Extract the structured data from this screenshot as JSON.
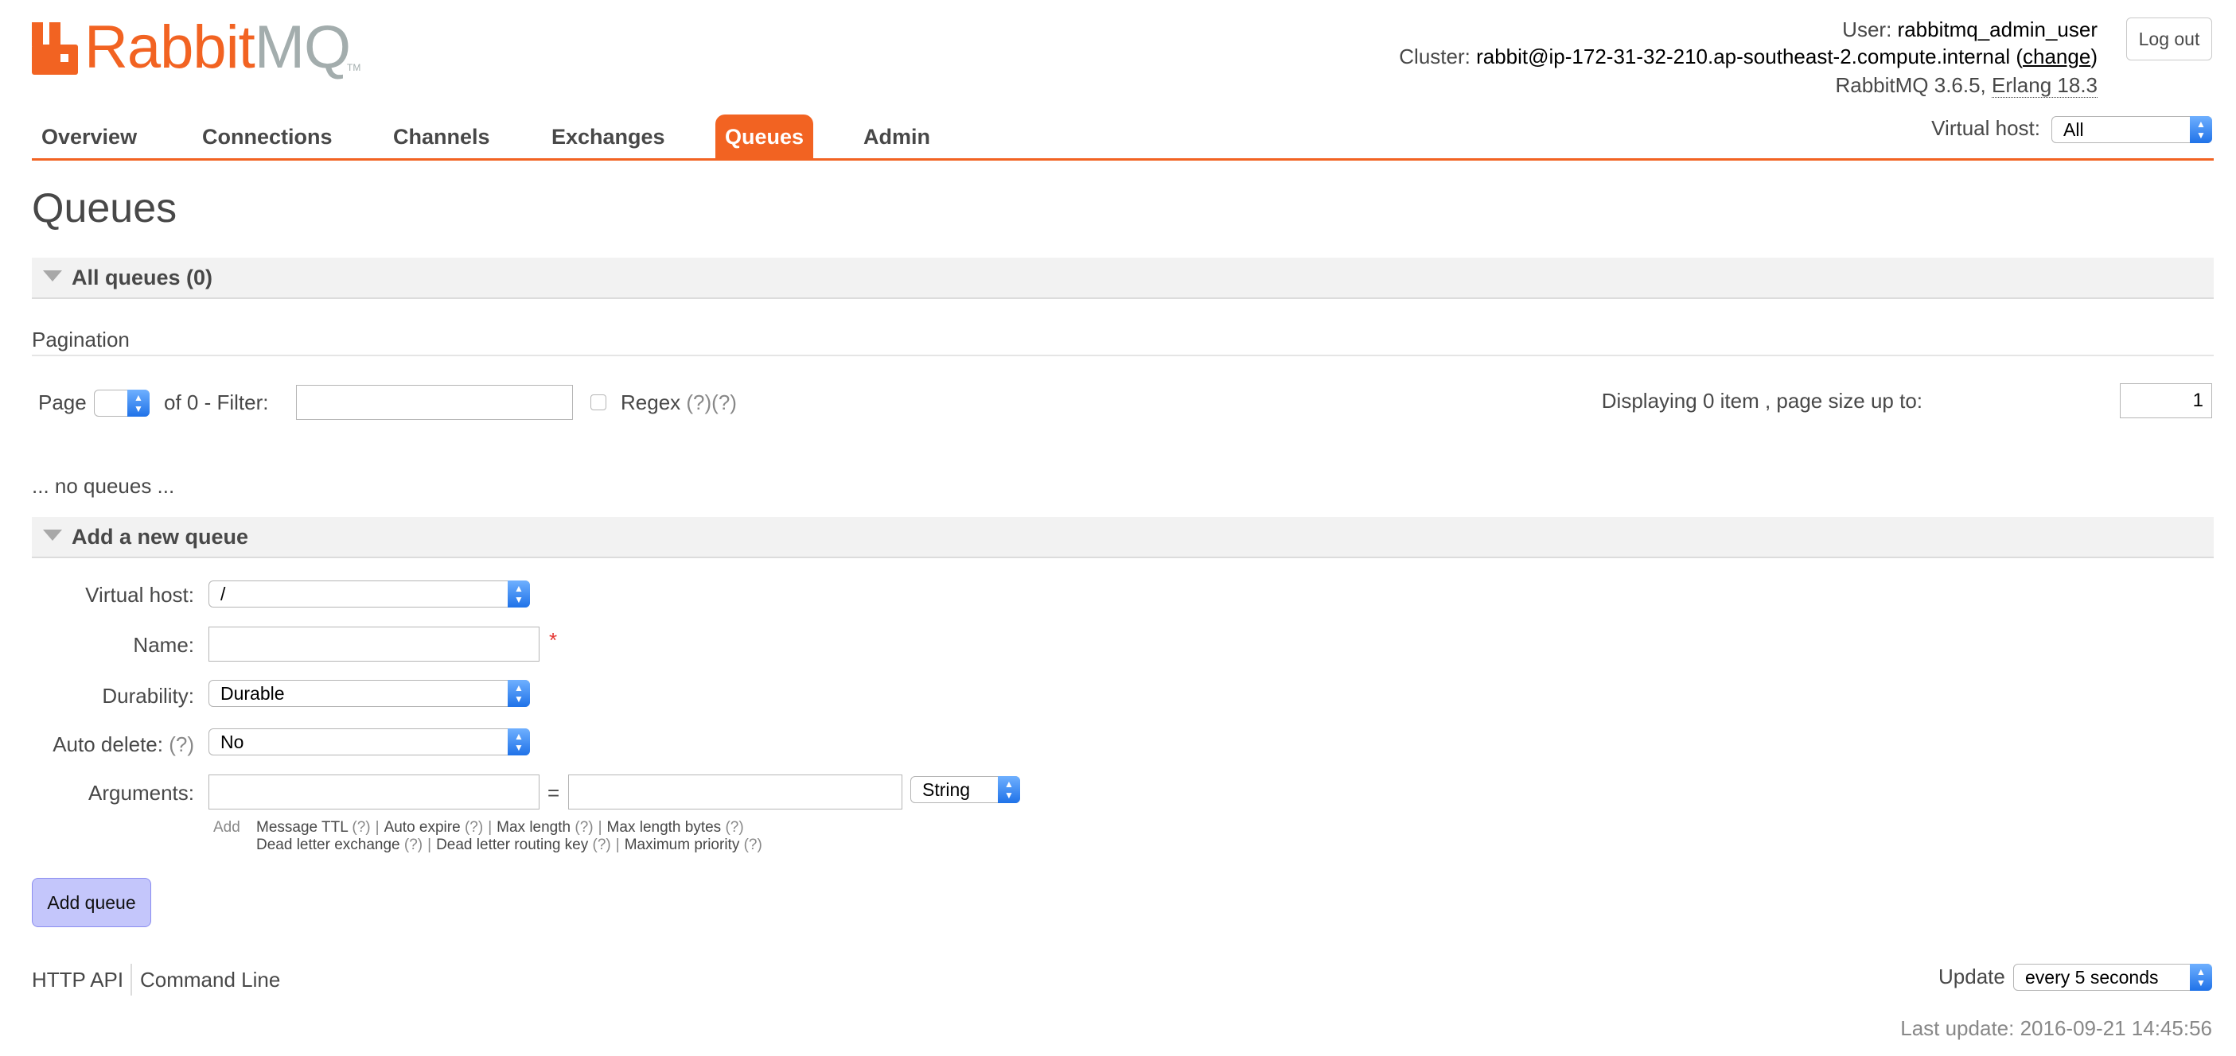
{
  "logo": {
    "text_rabbit": "Rabbit",
    "text_mq": "MQ",
    "tm": "TM",
    "brand_color": "#f26322"
  },
  "header": {
    "user_label": "User:",
    "user_value": "rabbitmq_admin_user",
    "cluster_label": "Cluster:",
    "cluster_value": "rabbit@ip-172-31-32-210.ap-southeast-2.compute.internal",
    "cluster_change": "change",
    "version": "RabbitMQ 3.6.5,",
    "erlang": "Erlang 18.3",
    "logout_label": "Log out"
  },
  "nav": {
    "items": [
      {
        "label": "Overview"
      },
      {
        "label": "Connections"
      },
      {
        "label": "Channels"
      },
      {
        "label": "Exchanges"
      },
      {
        "label": "Queues"
      },
      {
        "label": "Admin"
      }
    ],
    "active": "Queues",
    "vhost_label": "Virtual host:",
    "vhost_value": "All"
  },
  "page": {
    "title": "Queues"
  },
  "all_queues": {
    "header": "All queues (0)",
    "pagination_title": "Pagination",
    "page_label": "Page",
    "page_value": "",
    "of_label": "of 0  - Filter:",
    "filter_value": "",
    "regex_label": "Regex",
    "regex_help": "(?)(?)",
    "displaying": "Displaying 0 item , page size up to:",
    "page_size": "1",
    "empty_text": "... no queues ..."
  },
  "add_queue": {
    "header": "Add a new queue",
    "vhost_label": "Virtual host:",
    "vhost_value": "/",
    "name_label": "Name:",
    "name_value": "",
    "required_mark": "*",
    "durability_label": "Durability:",
    "durability_value": "Durable",
    "auto_delete_label": "Auto delete:",
    "auto_delete_help": "(?)",
    "auto_delete_value": "No",
    "arguments_label": "Arguments:",
    "arg_key": "",
    "eq": "=",
    "arg_value": "",
    "arg_type": "String",
    "add_label": "Add",
    "hints_row1": [
      {
        "label": "Message TTL",
        "help": "(?)"
      },
      {
        "label": "Auto expire",
        "help": "(?)"
      },
      {
        "label": "Max length",
        "help": "(?)"
      },
      {
        "label": "Max length bytes",
        "help": "(?)"
      }
    ],
    "hints_row2": [
      {
        "label": "Dead letter exchange",
        "help": "(?)"
      },
      {
        "label": "Dead letter routing key",
        "help": "(?)"
      },
      {
        "label": "Maximum priority",
        "help": "(?)"
      }
    ],
    "hint_separator": "|",
    "submit_label": "Add queue"
  },
  "footer": {
    "http_api": "HTTP API",
    "command_line": "Command Line",
    "update_label": "Update",
    "update_value": "every 5 seconds",
    "last_update": "Last update: 2016-09-21 14:45:56"
  }
}
